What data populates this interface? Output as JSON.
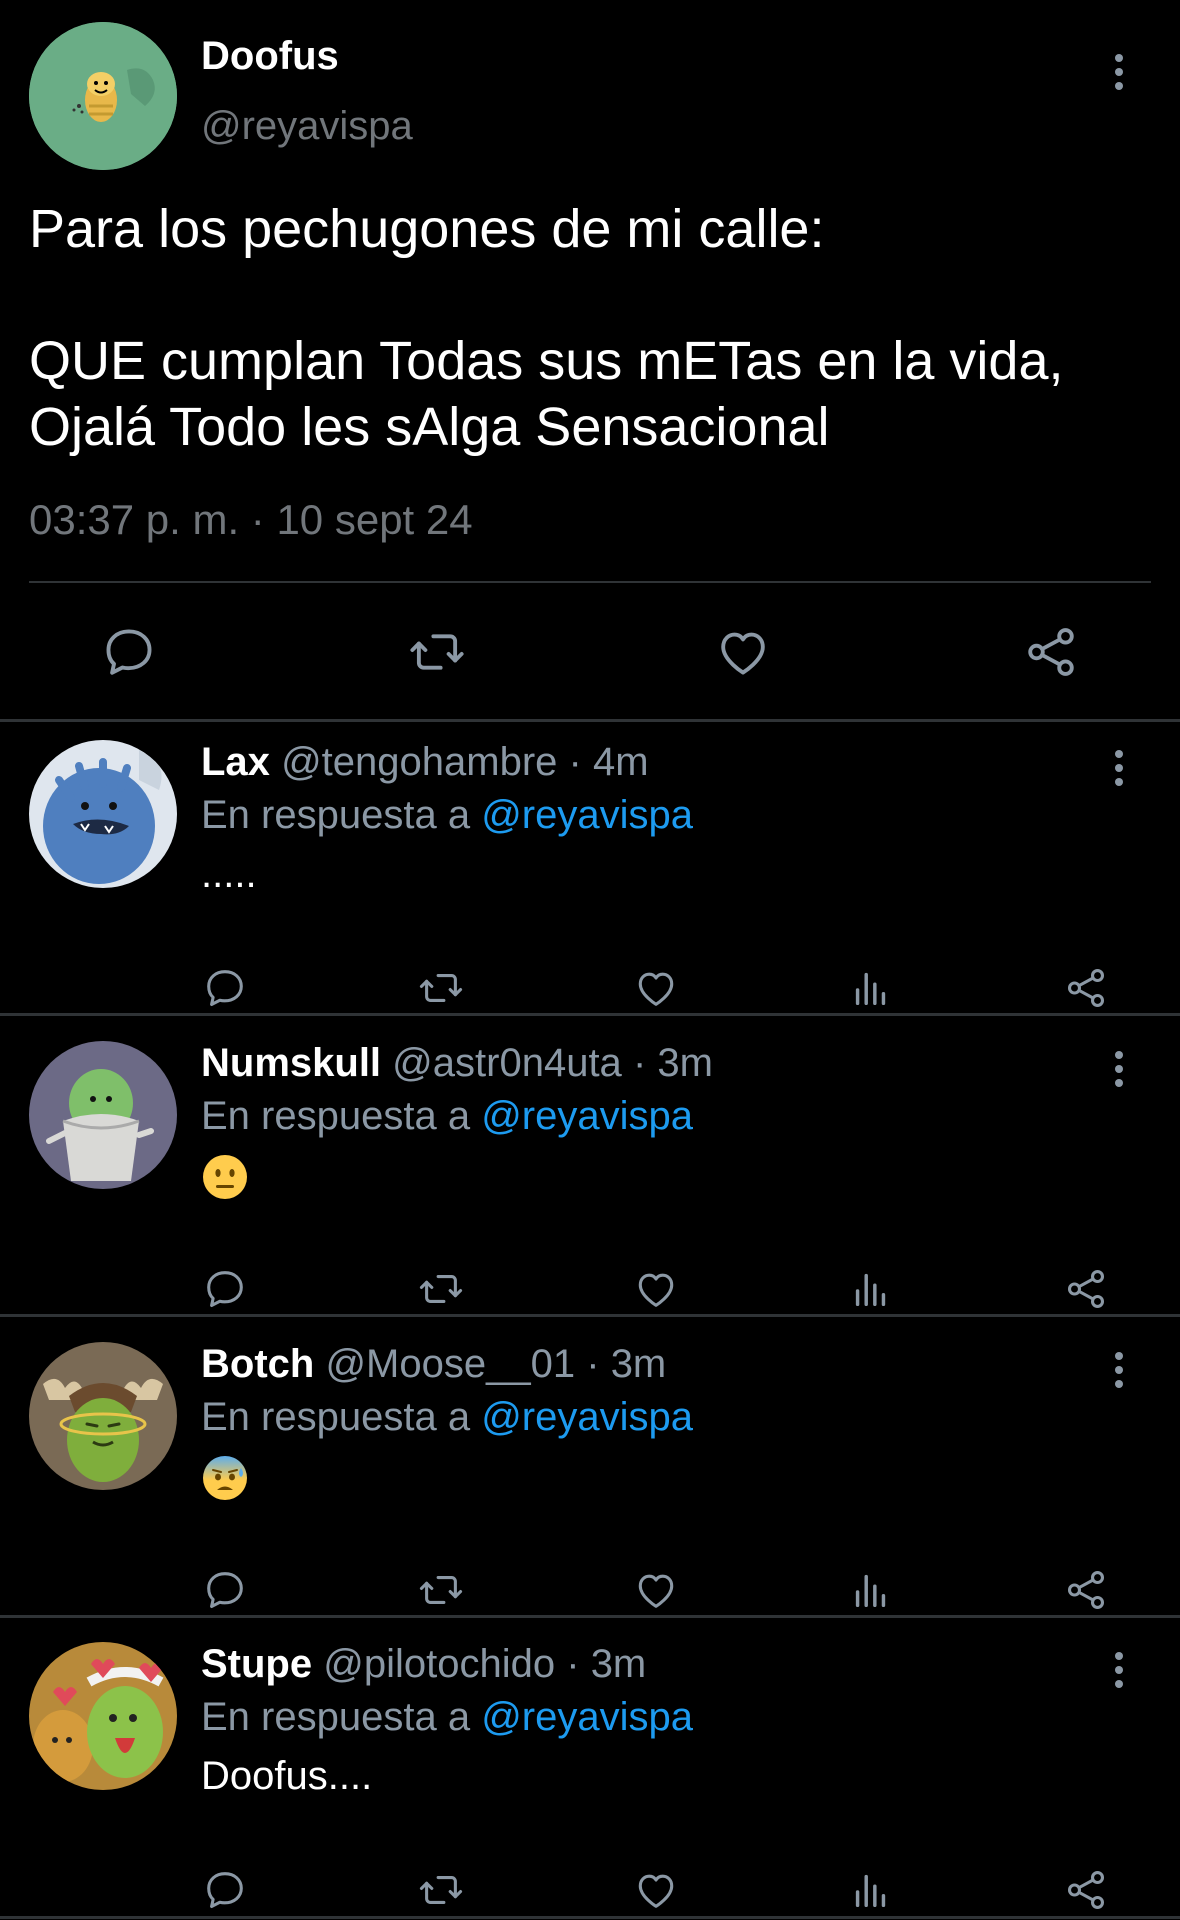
{
  "main_tweet": {
    "name": "Doofus",
    "handle": "@reyavispa",
    "text_line1": "Para los pechugones de mi calle:",
    "text_line2": "QUE cumplan Todas sus mETas en la vida, Ojalá Todo les sAlga Sensacional",
    "timestamp": "03:37 p. m. · 10 sept 24",
    "avatar_color": "#6aad86"
  },
  "reply_prefix": "En respuesta a",
  "colors": {
    "background": "#000000",
    "text": "#ffffff",
    "muted": "#8b98a5",
    "link": "#1d9bf0",
    "divider": "#2f3336"
  },
  "replies": [
    {
      "name": "Lax",
      "handle": "@tengohambre",
      "dot": "·",
      "time": "4m",
      "reply_to": "@reyavispa",
      "body": ".....",
      "avatar_color": "#4f7fbf",
      "body_type": "text"
    },
    {
      "name": "Numskull",
      "handle": "@astr0n4uta",
      "dot": "·",
      "time": "3m",
      "reply_to": "@reyavispa",
      "body": "",
      "emoji_icon": "neutral-face-icon",
      "avatar_color": "#6c6a86",
      "body_type": "emoji"
    },
    {
      "name": "Botch",
      "handle": "@Moose__01",
      "dot": "·",
      "time": "3m",
      "reply_to": "@reyavispa",
      "body": "",
      "emoji_icon": "anxious-face-with-sweat-icon",
      "avatar_color": "#7a6a55",
      "body_type": "emoji"
    },
    {
      "name": "Stupe",
      "handle": "@pilotochido",
      "dot": "·",
      "time": "3m",
      "reply_to": "@reyavispa",
      "body": "Doofus....",
      "avatar_color": "#b88a3a",
      "body_type": "text"
    }
  ],
  "icons": {
    "reply": "reply-icon",
    "retweet": "retweet-icon",
    "like": "like-icon",
    "views": "views-icon",
    "share": "share-icon",
    "more": "more-options-icon"
  }
}
